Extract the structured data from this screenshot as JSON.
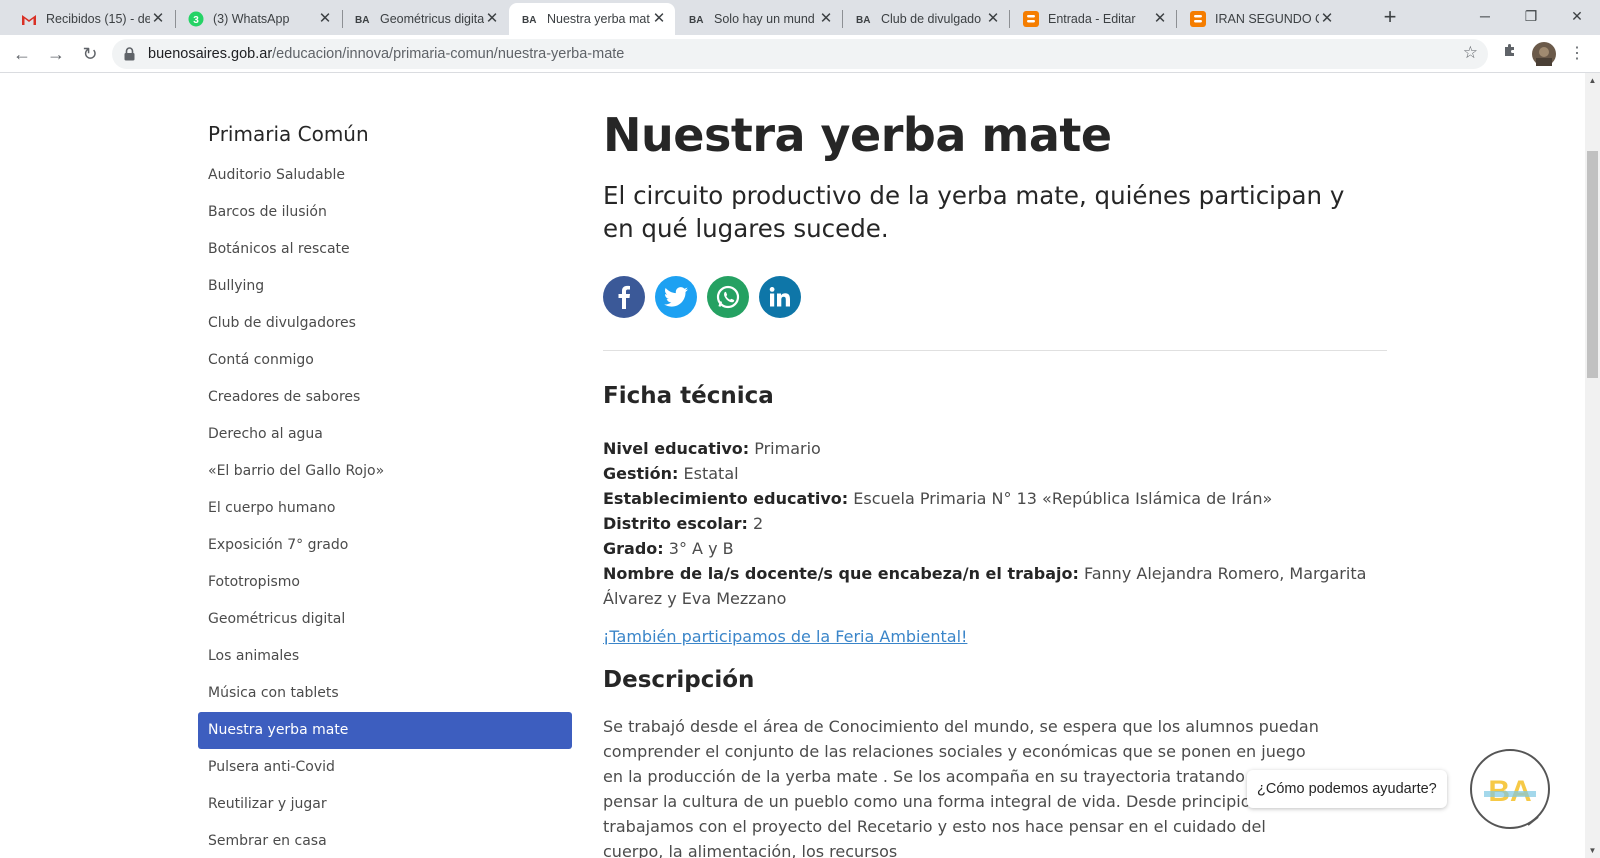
{
  "browser": {
    "tabs": [
      {
        "title": "Recibidos (15) - de",
        "favicon": "gmail-icon",
        "color": "#d93025"
      },
      {
        "title": "(3) WhatsApp",
        "favicon": "whatsapp-icon",
        "badge": "3",
        "color": "#25d366"
      },
      {
        "title": "Geométricus digita",
        "favicon": "ba-icon",
        "color": "#202124"
      },
      {
        "title": "Nuestra yerba mat",
        "favicon": "ba-icon",
        "color": "#202124",
        "active": true
      },
      {
        "title": "Solo hay un mund",
        "favicon": "ba-icon",
        "color": "#202124"
      },
      {
        "title": "Club de divulgado",
        "favicon": "ba-icon",
        "color": "#202124"
      },
      {
        "title": "Entrada - Editar",
        "favicon": "blogger-icon",
        "color": "#f57d00"
      },
      {
        "title": "IRAN SEGUNDO C",
        "favicon": "blogger-icon",
        "color": "#f57d00"
      }
    ],
    "url_host": "buenosaires.gob.ar",
    "url_path": "/educacion/innova/primaria-comun/nuestra-yerba-mate"
  },
  "sidebar": {
    "heading": "Primaria Común",
    "items": [
      {
        "label": "Auditorio Saludable"
      },
      {
        "label": "Barcos de ilusión"
      },
      {
        "label": "Botánicos al rescate"
      },
      {
        "label": "Bullying"
      },
      {
        "label": "Club de divulgadores"
      },
      {
        "label": "Contá conmigo"
      },
      {
        "label": "Creadores de sabores"
      },
      {
        "label": "Derecho al agua"
      },
      {
        "label": "«El barrio del Gallo Rojo»"
      },
      {
        "label": "El cuerpo humano"
      },
      {
        "label": "Exposición 7° grado"
      },
      {
        "label": "Fototropismo"
      },
      {
        "label": "Geométricus digital"
      },
      {
        "label": "Los animales"
      },
      {
        "label": "Música con tablets"
      },
      {
        "label": "Nuestra yerba mate",
        "active": true
      },
      {
        "label": "Pulsera anti-Covid"
      },
      {
        "label": "Reutilizar y jugar"
      },
      {
        "label": "Sembrar en casa"
      }
    ]
  },
  "main": {
    "title": "Nuestra yerba mate",
    "lead": "El circuito productivo de la yerba mate, quiénes participan y en qué lugares sucede.",
    "share": [
      {
        "icon": "facebook-icon",
        "color": "#3b5998"
      },
      {
        "icon": "twitter-icon",
        "color": "#1da1f2"
      },
      {
        "icon": "whatsapp-icon",
        "color": "#25a162"
      },
      {
        "icon": "linkedin-icon",
        "color": "#0e76a8"
      }
    ],
    "ficha_heading": "Ficha técnica",
    "fields": {
      "nivel_label": "Nivel educativo:",
      "nivel_value": "Primario",
      "gestion_label": "Gestión:",
      "gestion_value": "Estatal",
      "establecimiento_label": "Establecimiento educativo:",
      "establecimiento_value": "Escuela Primaria N° 13 «República Islámica de Irán»",
      "distrito_label": "Distrito escolar:",
      "distrito_value": "2",
      "grado_label": "Grado:",
      "grado_value": "3° A y B",
      "docentes_label": "Nombre de la/s docente/s que encabeza/n el trabajo:",
      "docentes_value": "Fanny Alejandra Romero, Margarita Álvarez y Eva Mezzano"
    },
    "feria_link": "¡También participamos de la Feria Ambiental!",
    "descripcion_heading": "Descripción",
    "descripcion": "Se trabajó desde el área de Conocimiento del mundo, se espera que los alumnos puedan comprender el conjunto de las relaciones sociales y económicas que se ponen en juego en la producción de la yerba mate . Se los acompaña en su trayectoria tratando de pensar la cultura de un pueblo como una forma integral de vida. Desde principio de año trabajamos con el proyecto del Recetario y esto nos hace pensar en el cuidado del cuerpo, la alimentación, los recursos"
  },
  "chat": {
    "prompt": "¿Cómo podemos ayudarte?",
    "logo_text": "BA"
  }
}
